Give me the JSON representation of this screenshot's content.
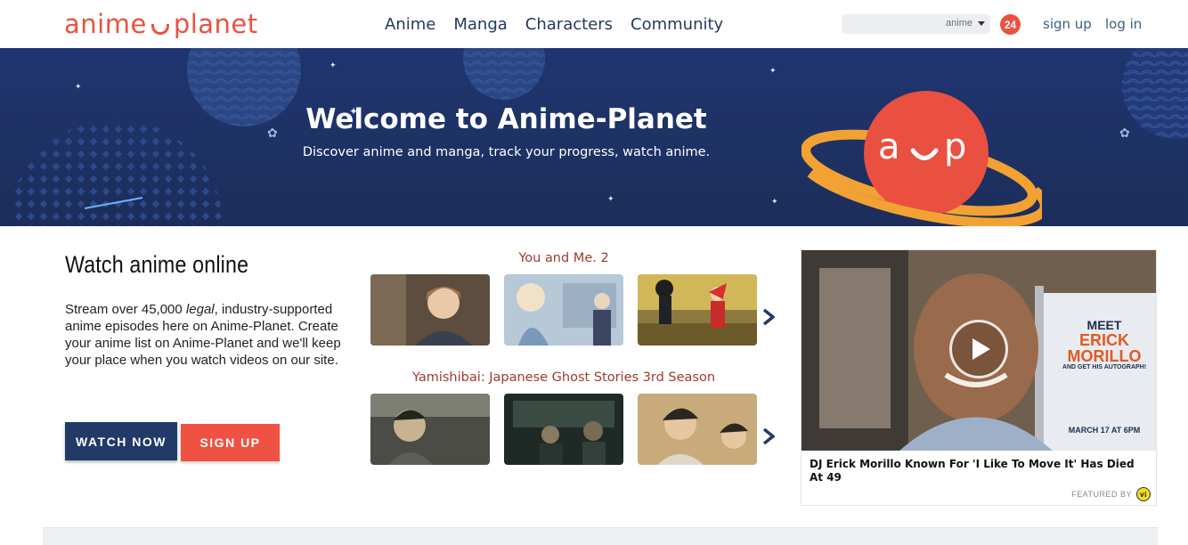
{
  "header": {
    "logo_left": "anime",
    "logo_right": "planet",
    "nav": [
      "Anime",
      "Manga",
      "Characters",
      "Community"
    ],
    "search": {
      "value": "",
      "placeholder": "",
      "type_selected": "anime"
    },
    "notification_count": "24",
    "signup_label": "sign up",
    "login_label": "log in"
  },
  "banner": {
    "title": "Welcome to Anime-Planet",
    "subtitle": "Discover anime and manga, track your progress, watch anime."
  },
  "watch": {
    "heading": "Watch anime online",
    "desc_before": "Stream over 45,000 ",
    "desc_emph": "legal",
    "desc_after": ", industry-supported anime episodes here on Anime-Planet. Create your anime list on Anime-Planet and we'll keep your place when you watch videos on our site.",
    "watch_now": "WATCH NOW",
    "sign_up": "SIGN UP"
  },
  "shows": [
    {
      "title": "You and Me. 2"
    },
    {
      "title": "Yamishibai: Japanese Ghost Stories 3rd Season"
    }
  ],
  "ad": {
    "caption": "DJ Erick Morillo Known For 'I Like To Move It' Has Died At 49",
    "featured_by": "FEATURED BY",
    "vi_label": "vi",
    "poster_lines": [
      "MEET",
      "ERICK",
      "MORILLO",
      "AND GET HIS AUTOGRAPH!",
      "MARCH 17 AT 6PM"
    ]
  },
  "colors": {
    "brand": "#e9523f",
    "navy": "#213a68",
    "banner": "#1d3163",
    "show_title": "#9e3a2c"
  }
}
